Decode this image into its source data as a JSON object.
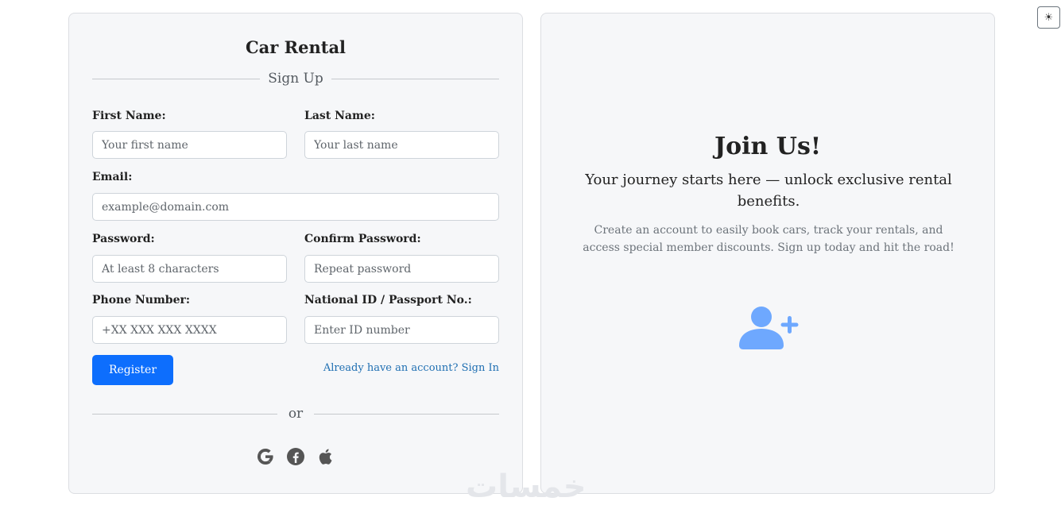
{
  "theme_toggle": {
    "icon": "sun-icon",
    "glyph": "☀"
  },
  "form": {
    "app_title": "Car Rental",
    "section_title": "Sign Up",
    "fields": {
      "first_name": {
        "label": "First Name:",
        "placeholder": "Your first name"
      },
      "last_name": {
        "label": "Last Name:",
        "placeholder": "Your last name"
      },
      "email": {
        "label": "Email:",
        "placeholder": "example@domain.com"
      },
      "password": {
        "label": "Password:",
        "placeholder": "At least 8 characters"
      },
      "confirm_password": {
        "label": "Confirm Password:",
        "placeholder": "Repeat password"
      },
      "phone": {
        "label": "Phone Number:",
        "placeholder": "+XX XXX XXX XXXX"
      },
      "national_id": {
        "label": "National ID / Passport No.:",
        "placeholder": "Enter ID number"
      }
    },
    "register_label": "Register",
    "signin_link": "Already have an account? Sign In",
    "or_text": "or",
    "social_icons": [
      "google-icon",
      "facebook-icon",
      "apple-icon"
    ]
  },
  "promo": {
    "title": "Join Us!",
    "subtitle": "Your journey starts here — unlock exclusive rental benefits.",
    "description": "Create an account to easily book cars, track your rentals, and access special member discounts. Sign up today and hit the road!",
    "icon": "user-plus-icon",
    "icon_color": "#6ea8fe"
  },
  "watermark": "خمسات",
  "colors": {
    "primary": "#0d6efd",
    "link": "#1f6fb2",
    "card_bg": "#f6f7f9"
  }
}
